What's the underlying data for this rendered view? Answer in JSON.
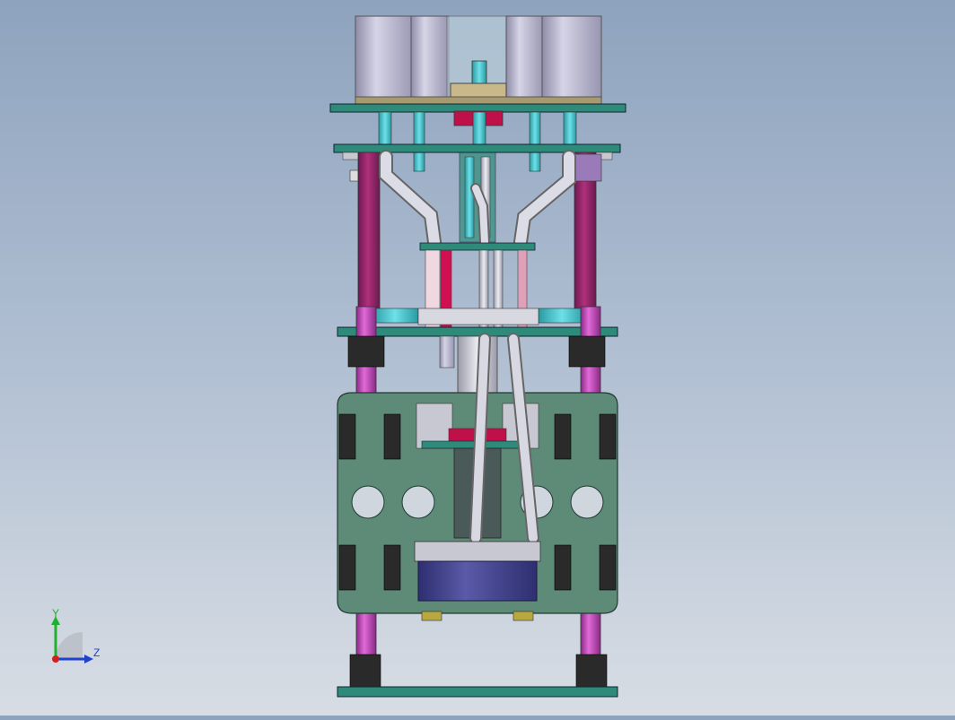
{
  "viewport": {
    "background_top": "#8ea3be",
    "background_bottom": "#d8dde4"
  },
  "model": {
    "frame_color": "#2e8b7a",
    "post_color": "#c040b8",
    "cylinder_color": "#b0aec8",
    "tube_color": "#c8c8d2",
    "motor_color": "#3c3c8c",
    "accent_red": "#c0104a",
    "accent_cyan": "#40c8d0"
  },
  "triad": {
    "y_label": "Y",
    "z_label": "Z",
    "y_color": "#20b030",
    "z_color": "#2040d0",
    "x_color": "#d02020"
  }
}
